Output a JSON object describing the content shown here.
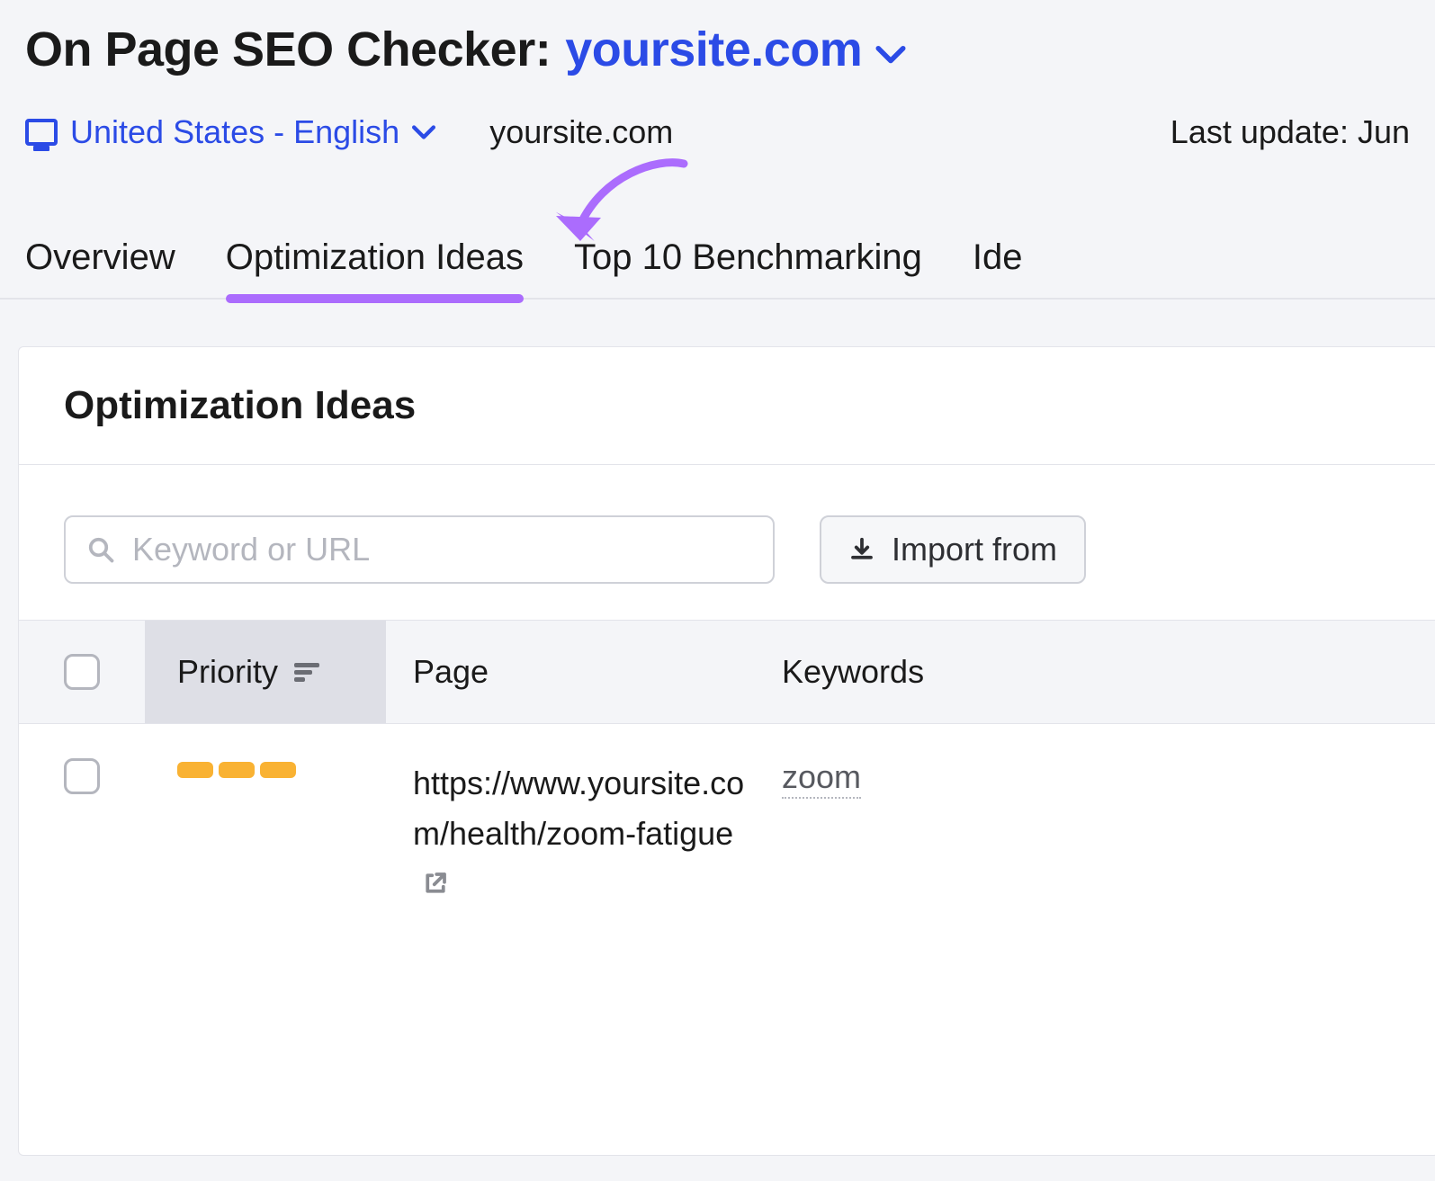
{
  "header": {
    "title_prefix": "On Page SEO Checker:",
    "site": "yoursite.com",
    "locale": "United States - English",
    "domain": "yoursite.com",
    "last_update": "Last update: Jun"
  },
  "tabs": {
    "overview": "Overview",
    "optimization": "Optimization Ideas",
    "benchmarking": "Top 10 Benchmarking",
    "ideas_partial": "Ide"
  },
  "panel": {
    "title": "Optimization Ideas",
    "search_placeholder": "Keyword or URL",
    "import_label": "Import from"
  },
  "table": {
    "headers": {
      "priority": "Priority",
      "page": "Page",
      "keywords": "Keywords"
    },
    "rows": [
      {
        "priority_bars": 3,
        "page": "https://www.yoursite.com/health/zoom-fatigue",
        "keyword": "zoom"
      }
    ]
  },
  "colors": {
    "accent_blue": "#2b4be6",
    "accent_purple": "#ab6cfd",
    "priority_orange": "#f9b233"
  }
}
